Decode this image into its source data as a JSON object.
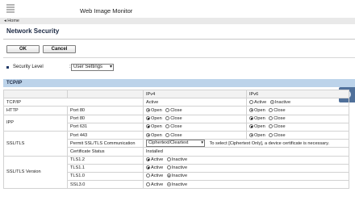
{
  "header": {
    "title": "Web Image Monitor"
  },
  "breadcrumb": {
    "home": "◂ Home"
  },
  "page": {
    "title": "Network Security"
  },
  "buttons": {
    "ok": "OK",
    "cancel": "Cancel"
  },
  "security_level": {
    "label": "Security Level",
    "colon": ":",
    "value": "User Settings"
  },
  "section": {
    "label": "TCP/IP"
  },
  "table": {
    "col_ipv4": "IPv4",
    "col_ipv6": "IPv6",
    "tcpip": {
      "label": "TCP/IP",
      "ipv4_status": "Active",
      "ipv6_active": "Active",
      "ipv6_inactive": "Inactive"
    },
    "http": {
      "label": "HTTP",
      "port": "Port 80",
      "open": "Open",
      "close": "Close"
    },
    "ipp": {
      "label": "IPP",
      "port1": "Port 80",
      "port2": "Port 631"
    },
    "ssl": {
      "label": "SSL/TLS",
      "port": "Port 443",
      "comm_label": "Permit SSL/TLS Communication",
      "comm_value": "Ciphertext/Cleartext",
      "comm_note": "To select [Ciphertext Only], a device certificate is necessary.",
      "cert_label": "Certificate Status",
      "cert_value": "Installed"
    },
    "tls_version": {
      "label": "SSL/TLS Version",
      "v12": "TLS1.2",
      "v11": "TLS1.1",
      "v10": "TLS1.0",
      "ssl30": "SSL3.0",
      "active": "Active",
      "inactive": "Inactive"
    },
    "open": "Open",
    "close": "Close"
  }
}
